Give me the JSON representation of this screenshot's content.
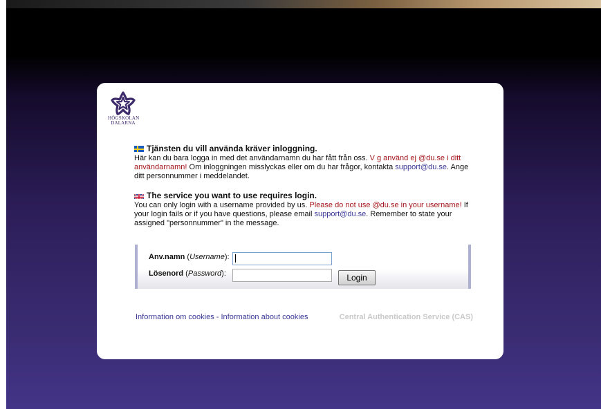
{
  "logo": {
    "line1": "HÖGSKOLAN",
    "line2": "DALARNA"
  },
  "swedish": {
    "heading": "Tjänsten du vill använda kräver inloggning.",
    "text_1": "Här kan du bara logga in med det användarnamn du har fått från oss. ",
    "warning": "V g använd ej @du.se i ditt användarnamn!",
    "text_2": " Om inloggningen misslyckas eller om du har frågor, kontakta ",
    "email": "support@du.se",
    "text_3": ". Ange ditt personnummer i meddelandet."
  },
  "english": {
    "heading": "The service you want to use requires login.",
    "text_1": "You can only login with a username provided by us. ",
    "warning": "Please do not use @du.se in your username!",
    "text_2": " If your login fails or if you have questions, please email ",
    "email": "support@du.se",
    "text_3": ". Remember to state your assigned \"personnummer\" in the message."
  },
  "login_form": {
    "username_label": "Anv.namn",
    "username_label_en": "Username",
    "username_value": "",
    "password_label": "Lösenord",
    "password_label_en": "Password",
    "password_value": "",
    "login_button": "Login"
  },
  "footer": {
    "cookies_sv": "Information om cookies",
    "separator": " - ",
    "cookies_en": "Information about cookies",
    "cas": "Central Authentication Service (CAS)"
  },
  "colors": {
    "warning": "#a4151a",
    "link": "#3b3897",
    "brand_purple": "#3d2b6b"
  }
}
